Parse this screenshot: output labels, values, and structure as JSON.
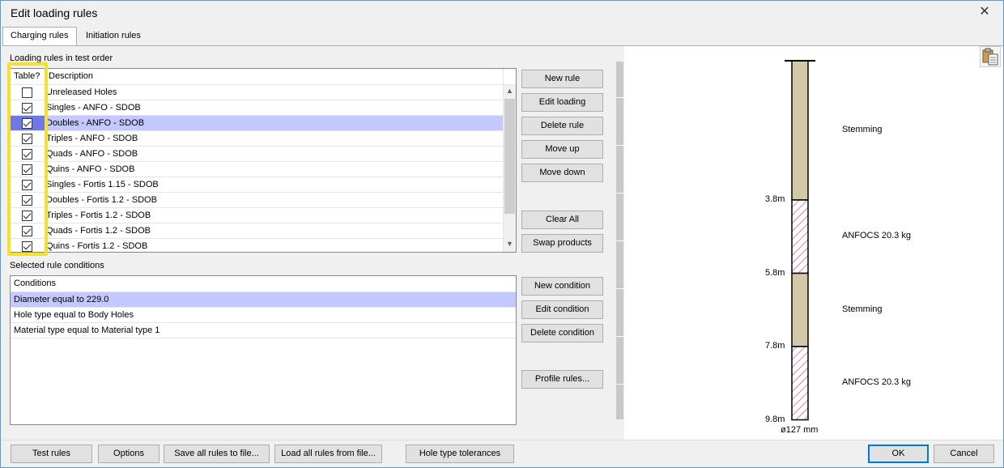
{
  "window": {
    "title": "Edit loading rules"
  },
  "tabs": [
    {
      "label": "Charging rules",
      "active": true
    },
    {
      "label": "Initiation rules",
      "active": false
    }
  ],
  "rules": {
    "section_label": "Loading rules in test order",
    "col_table": "Table?",
    "col_description": "Description",
    "items": [
      {
        "checked": false,
        "label": "Unreleased Holes",
        "selected": false
      },
      {
        "checked": true,
        "label": "Singles - ANFO - SDOB",
        "selected": false
      },
      {
        "checked": true,
        "label": "Doubles - ANFO - SDOB",
        "selected": true
      },
      {
        "checked": true,
        "label": "Triples - ANFO - SDOB",
        "selected": false
      },
      {
        "checked": true,
        "label": "Quads - ANFO - SDOB",
        "selected": false
      },
      {
        "checked": true,
        "label": "Quins - ANFO - SDOB",
        "selected": false
      },
      {
        "checked": true,
        "label": "Singles - Fortis 1.15 - SDOB",
        "selected": false
      },
      {
        "checked": true,
        "label": "Doubles - Fortis 1.2 - SDOB",
        "selected": false
      },
      {
        "checked": true,
        "label": "Triples - Fortis 1.2 - SDOB",
        "selected": false
      },
      {
        "checked": true,
        "label": "Quads - Fortis 1.2 - SDOB",
        "selected": false
      },
      {
        "checked": true,
        "label": "Quins - Fortis 1.2 - SDOB",
        "selected": false
      }
    ],
    "buttons": {
      "new_rule": "New rule",
      "edit_loading": "Edit loading",
      "delete_rule": "Delete rule",
      "move_up": "Move up",
      "move_down": "Move down",
      "clear_all": "Clear All",
      "swap_products": "Swap products"
    }
  },
  "conditions": {
    "section_label": "Selected rule conditions",
    "col_header": "Conditions",
    "items": [
      {
        "label": "Diameter equal to 229.0",
        "selected": true
      },
      {
        "label": "Hole type equal to Body Holes",
        "selected": false
      },
      {
        "label": "Material type equal to Material type 1",
        "selected": false
      }
    ],
    "buttons": {
      "new_condition": "New condition",
      "edit_condition": "Edit condition",
      "delete_condition": "Delete condition",
      "profile_rules": "Profile rules..."
    }
  },
  "preview": {
    "depths": [
      "3.8m",
      "5.8m",
      "7.8m",
      "9.8m"
    ],
    "segments": [
      {
        "label": "Stemming",
        "kind": "stemming"
      },
      {
        "label": "ANFOCS 20.3 kg",
        "kind": "explosive"
      },
      {
        "label": "Stemming",
        "kind": "stemming"
      },
      {
        "label": "ANFOCS 20.3 kg",
        "kind": "explosive"
      }
    ],
    "diameter": "ø127 mm",
    "colors": {
      "stemming": "#d3c9a8",
      "explosive_hatch": "#cc3377"
    }
  },
  "footer": {
    "test_rules": "Test rules",
    "options": "Options",
    "save_all": "Save all rules to file...",
    "load_all": "Load all rules from file...",
    "hole_type_tolerances": "Hole type tolerances",
    "ok": "OK",
    "cancel": "Cancel"
  }
}
